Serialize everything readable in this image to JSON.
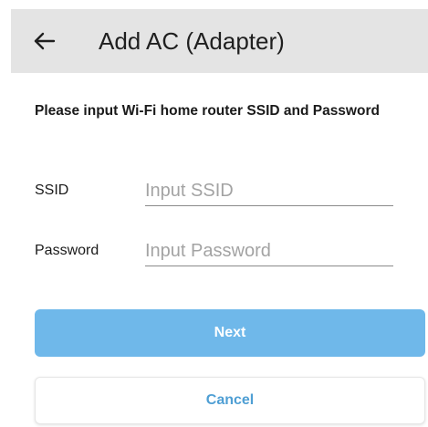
{
  "app_bar": {
    "title": "Add AC (Adapter)",
    "back_icon": "arrow-left-icon"
  },
  "form": {
    "instructions": "Please input Wi-Fi home router SSID and Password",
    "ssid": {
      "label": "SSID",
      "placeholder": "Input SSID",
      "value": ""
    },
    "password": {
      "label": "Password",
      "placeholder": "Input Password",
      "value": ""
    }
  },
  "actions": {
    "next_label": "Next",
    "cancel_label": "Cancel"
  },
  "colors": {
    "app_bar_bg": "#e4e4e4",
    "primary_button": "#6fb8ea",
    "cancel_text": "#4f9fd4",
    "placeholder": "#a3a3a3"
  }
}
